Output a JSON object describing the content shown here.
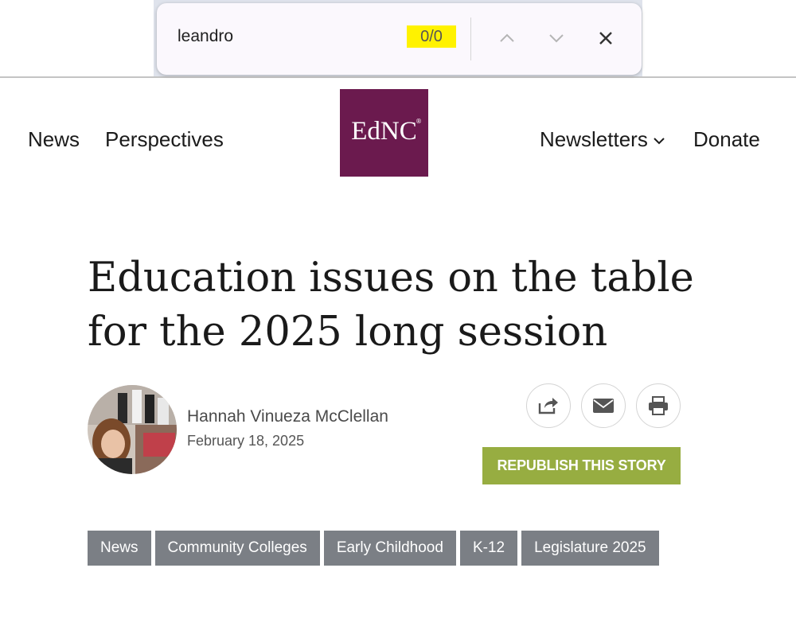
{
  "find_bar": {
    "query": "leandro",
    "match_count": "0/0",
    "highlight_color": "#fff200"
  },
  "site_nav": {
    "left_links": [
      "News",
      "Perspectives"
    ],
    "logo_text": "EdNC",
    "logo_mark": "®",
    "logo_color": "#6b1a4e",
    "newsletters_label": "Newsletters",
    "donate_label": "Donate"
  },
  "article": {
    "headline_line1": "Education issues on the table",
    "headline_line2": "for the 2025 long session",
    "author": "Hannah Vinueza McClellan",
    "date": "February 18, 2025",
    "share_icons": [
      "share-icon",
      "email-icon",
      "print-icon"
    ],
    "republish_label": "REPUBLISH THIS STORY",
    "republish_color": "#97ad41",
    "tags": [
      "News",
      "Community Colleges",
      "Early Childhood",
      "K-12",
      "Legislature 2025"
    ]
  }
}
